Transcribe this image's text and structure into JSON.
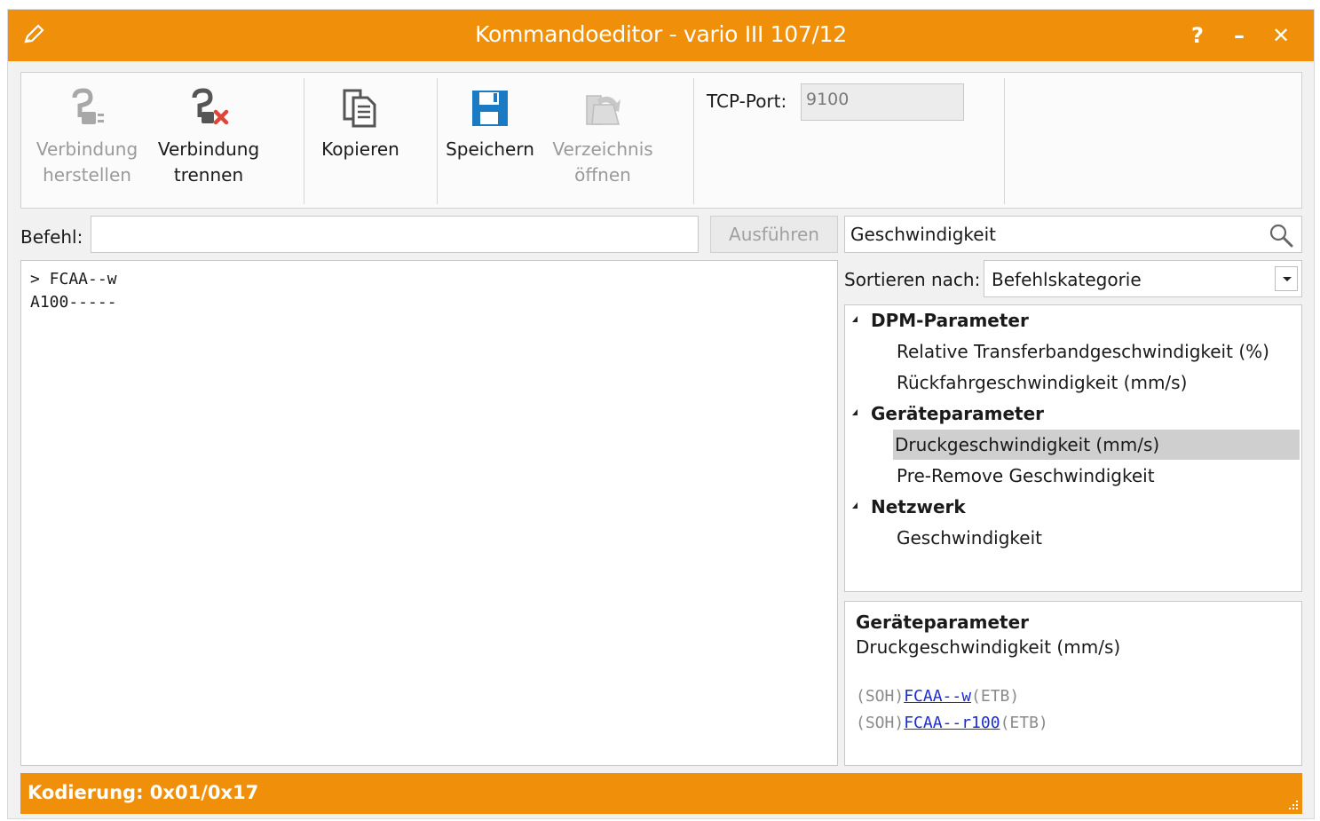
{
  "window": {
    "title": "Kommandoeditor - vario III 107/12",
    "help_label": "?",
    "minimize_label": "–",
    "close_label": "✕"
  },
  "toolbar": {
    "connect": {
      "line1": "Verbindung",
      "line2": "herstellen",
      "enabled": false
    },
    "disconnect": {
      "line1": "Verbindung",
      "line2": "trennen",
      "enabled": true
    },
    "copy": {
      "line1": "Kopieren"
    },
    "save": {
      "line1": "Speichern"
    },
    "open_dir": {
      "line1": "Verzeichnis",
      "line2": "öffnen",
      "enabled": false
    },
    "tcp_port_label": "TCP-Port:",
    "tcp_port_value": "9100"
  },
  "command": {
    "label": "Befehl:",
    "value": "",
    "execute_label": "Ausführen"
  },
  "search": {
    "value": "Geschwindigkeit"
  },
  "console": {
    "lines": [
      "> FCAA--w",
      "A100-----"
    ]
  },
  "sort": {
    "label": "Sortieren nach:",
    "value": "Befehlskategorie"
  },
  "tree": {
    "categories": [
      {
        "label": "DPM-Parameter",
        "items": [
          "Relative Transferbandgeschwindigkeit (%)",
          "Rückfahrgeschwindigkeit (mm/s)"
        ]
      },
      {
        "label": "Geräteparameter",
        "items": [
          "Druckgeschwindigkeit (mm/s)",
          "Pre-Remove Geschwindigkeit"
        ]
      },
      {
        "label": "Netzwerk",
        "items": [
          "Geschwindigkeit"
        ]
      }
    ],
    "selected": "Druckgeschwindigkeit (mm/s)"
  },
  "detail": {
    "category": "Geräteparameter",
    "item": "Druckgeschwindigkeit (mm/s)",
    "code_lines": [
      {
        "prefix": "(SOH)",
        "cmd": "FCAA--w",
        "suffix": "(ETB)"
      },
      {
        "prefix": "(SOH)",
        "cmd": "FCAA--r100",
        "suffix": "(ETB)"
      }
    ]
  },
  "status": {
    "text": "Kodierung: 0x01/0x17"
  },
  "colors": {
    "accent": "#f0900a",
    "toolbar_icon": "#1a7ac4",
    "disabled": "#9a9a9a",
    "link": "#1a2bd8",
    "delete_red": "#e0453a"
  }
}
